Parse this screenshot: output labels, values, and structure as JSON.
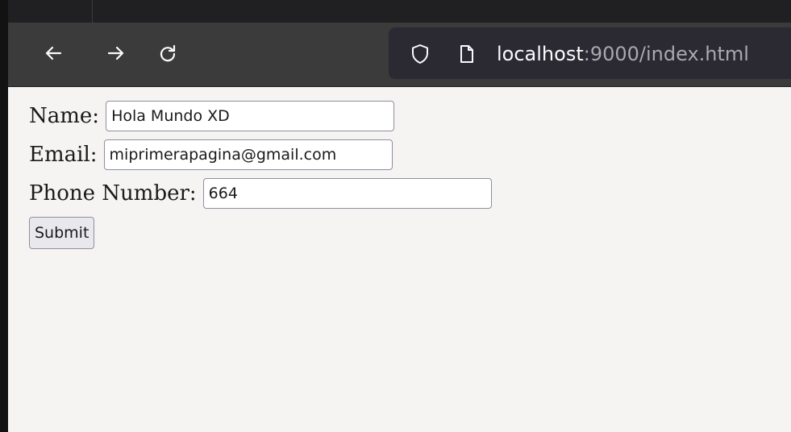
{
  "browser": {
    "icons": {
      "back": "arrow-left-icon",
      "forward": "arrow-right-icon",
      "reload": "reload-icon",
      "tracking_protection": "shield-icon",
      "page_info": "page-icon"
    },
    "url": {
      "host": "localhost",
      "rest": ":9000/index.html"
    }
  },
  "form": {
    "name": {
      "label": "Name:",
      "value": "Hola Mundo XD"
    },
    "email": {
      "label": "Email:",
      "value": "miprimerapagina@gmail.com"
    },
    "phone": {
      "label": "Phone Number:",
      "value": "664"
    },
    "submit_label": "Submit"
  },
  "colors": {
    "toolbar_bg": "#3b3b3b",
    "urlbar_bg": "#2b2a33",
    "page_bg": "#f5f4f3"
  }
}
